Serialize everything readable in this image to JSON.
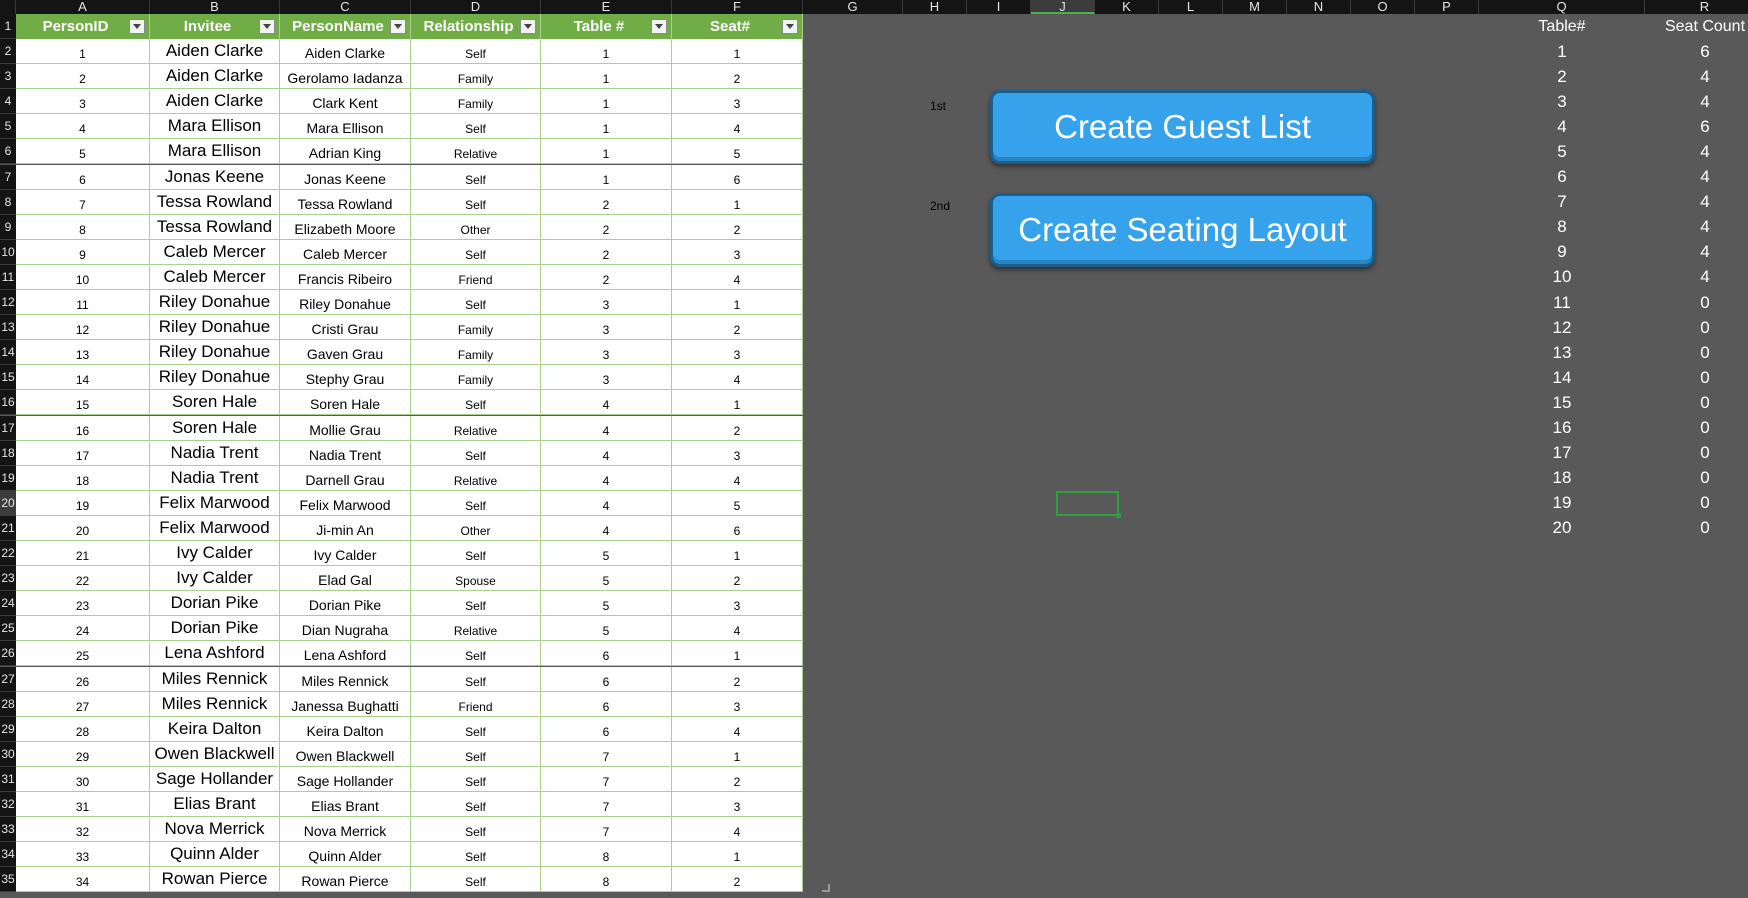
{
  "columns": [
    "A",
    "B",
    "C",
    "D",
    "E",
    "F",
    "G",
    "H",
    "I",
    "J",
    "K",
    "L",
    "M",
    "N",
    "O",
    "P",
    "Q",
    "R"
  ],
  "selected_column": "J",
  "selected_row": 20,
  "rows": [
    1,
    2,
    3,
    4,
    5,
    6,
    7,
    8,
    9,
    10,
    11,
    12,
    13,
    14,
    15,
    16,
    17,
    18,
    19,
    20,
    21,
    22,
    23,
    24,
    25,
    26,
    27,
    28,
    29,
    30,
    31,
    32,
    33,
    34,
    35
  ],
  "table": {
    "headers": [
      "PersonID",
      "Invitee",
      "PersonName",
      "Relationship",
      "Table #",
      "Seat#"
    ],
    "records": [
      [
        "1",
        "Aiden Clarke",
        "Aiden Clarke",
        "Self",
        "1",
        "1"
      ],
      [
        "2",
        "Aiden Clarke",
        "Gerolamo Iadanza",
        "Family",
        "1",
        "2"
      ],
      [
        "3",
        "Aiden Clarke",
        "Clark Kent",
        "Family",
        "1",
        "3"
      ],
      [
        "4",
        "Mara Ellison",
        "Mara Ellison",
        "Self",
        "1",
        "4"
      ],
      [
        "5",
        "Mara Ellison",
        "Adrian King",
        "Relative",
        "1",
        "5"
      ],
      [
        "6",
        "Jonas Keene",
        "Jonas Keene",
        "Self",
        "1",
        "6"
      ],
      [
        "7",
        "Tessa Rowland",
        "Tessa Rowland",
        "Self",
        "2",
        "1"
      ],
      [
        "8",
        "Tessa Rowland",
        "Elizabeth Moore",
        "Other",
        "2",
        "2"
      ],
      [
        "9",
        "Caleb Mercer",
        "Caleb Mercer",
        "Self",
        "2",
        "3"
      ],
      [
        "10",
        "Caleb Mercer",
        "Francis Ribeiro",
        "Friend",
        "2",
        "4"
      ],
      [
        "11",
        "Riley Donahue",
        "Riley Donahue",
        "Self",
        "3",
        "1"
      ],
      [
        "12",
        "Riley Donahue",
        "Cristi Grau",
        "Family",
        "3",
        "2"
      ],
      [
        "13",
        "Riley Donahue",
        "Gaven Grau",
        "Family",
        "3",
        "3"
      ],
      [
        "14",
        "Riley Donahue",
        "Stephy Grau",
        "Family",
        "3",
        "4"
      ],
      [
        "15",
        "Soren Hale",
        "Soren Hale",
        "Self",
        "4",
        "1"
      ],
      [
        "16",
        "Soren Hale",
        "Mollie Grau",
        "Relative",
        "4",
        "2"
      ],
      [
        "17",
        "Nadia Trent",
        "Nadia Trent",
        "Self",
        "4",
        "3"
      ],
      [
        "18",
        "Nadia Trent",
        "Darnell Grau",
        "Relative",
        "4",
        "4"
      ],
      [
        "19",
        "Felix Marwood",
        "Felix Marwood",
        "Self",
        "4",
        "5"
      ],
      [
        "20",
        "Felix Marwood",
        "Ji-min An",
        "Other",
        "4",
        "6"
      ],
      [
        "21",
        "Ivy Calder",
        "Ivy Calder",
        "Self",
        "5",
        "1"
      ],
      [
        "22",
        "Ivy Calder",
        "Elad Gal",
        "Spouse",
        "5",
        "2"
      ],
      [
        "23",
        "Dorian Pike",
        "Dorian Pike",
        "Self",
        "5",
        "3"
      ],
      [
        "24",
        "Dorian Pike",
        "Dian Nugraha",
        "Relative",
        "5",
        "4"
      ],
      [
        "25",
        "Lena Ashford",
        "Lena Ashford",
        "Self",
        "6",
        "1"
      ],
      [
        "26",
        "Miles Rennick",
        "Miles Rennick",
        "Self",
        "6",
        "2"
      ],
      [
        "27",
        "Miles Rennick",
        "Janessa Bughatti",
        "Friend",
        "6",
        "3"
      ],
      [
        "28",
        "Keira Dalton",
        "Keira Dalton",
        "Self",
        "6",
        "4"
      ],
      [
        "29",
        "Owen Blackwell",
        "Owen Blackwell",
        "Self",
        "7",
        "1"
      ],
      [
        "30",
        "Sage Hollander",
        "Sage Hollander",
        "Self",
        "7",
        "2"
      ],
      [
        "31",
        "Elias Brant",
        "Elias Brant",
        "Self",
        "7",
        "3"
      ],
      [
        "32",
        "Nova Merrick",
        "Nova Merrick",
        "Self",
        "7",
        "4"
      ],
      [
        "33",
        "Quinn Alder",
        "Quinn Alder",
        "Self",
        "8",
        "1"
      ],
      [
        "34",
        "Rowan Pierce",
        "Rowan Pierce",
        "Self",
        "8",
        "2"
      ]
    ]
  },
  "summary": {
    "headers": [
      "Table#",
      "Seat Count"
    ],
    "rows": [
      [
        "1",
        "6"
      ],
      [
        "2",
        "4"
      ],
      [
        "3",
        "4"
      ],
      [
        "4",
        "6"
      ],
      [
        "5",
        "4"
      ],
      [
        "6",
        "4"
      ],
      [
        "7",
        "4"
      ],
      [
        "8",
        "4"
      ],
      [
        "9",
        "4"
      ],
      [
        "10",
        "4"
      ],
      [
        "11",
        "0"
      ],
      [
        "12",
        "0"
      ],
      [
        "13",
        "0"
      ],
      [
        "14",
        "0"
      ],
      [
        "15",
        "0"
      ],
      [
        "16",
        "0"
      ],
      [
        "17",
        "0"
      ],
      [
        "18",
        "0"
      ],
      [
        "19",
        "0"
      ],
      [
        "20",
        "0"
      ]
    ]
  },
  "buttons": {
    "guest_list": "Create Guest List",
    "seating_layout": "Create Seating Layout"
  },
  "step_labels": {
    "first": "1st",
    "second": "2nd"
  },
  "colors": {
    "table_header": "#70ad47",
    "grid_border": "#a9d08e",
    "sheet_background": "#595959",
    "button": "#35a2eb"
  }
}
